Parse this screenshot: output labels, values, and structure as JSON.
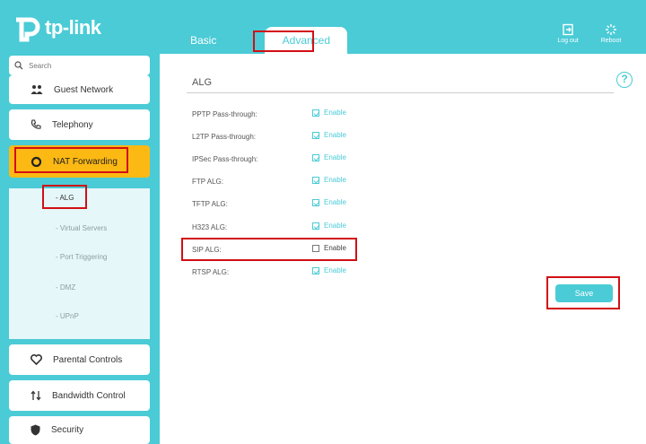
{
  "brand": {
    "logo_text": "tp-link"
  },
  "tabs": [
    {
      "label": "Basic"
    },
    {
      "label": "Advanced"
    }
  ],
  "header_actions": [
    {
      "label": "Log out",
      "icon": "logout-icon"
    },
    {
      "label": "Reboot",
      "icon": "reboot-icon"
    }
  ],
  "sidebar": {
    "search_placeholder": "Search",
    "items": [
      {
        "label": "Guest Network",
        "icon": "guest-network-icon"
      },
      {
        "label": "Telephony",
        "icon": "phone-icon"
      },
      {
        "label": "NAT Forwarding",
        "icon": "nat-icon"
      },
      {
        "label": "Parental Controls",
        "icon": "heart-icon"
      },
      {
        "label": "Bandwidth Control",
        "icon": "arrows-icon"
      },
      {
        "label": "Security",
        "icon": "shield-icon"
      }
    ],
    "sub_items": [
      {
        "label": "- ALG"
      },
      {
        "label": "- Virtual Servers"
      },
      {
        "label": "- Port Triggering"
      },
      {
        "label": "- DMZ"
      },
      {
        "label": "- UPnP"
      }
    ]
  },
  "main": {
    "section_title": "ALG",
    "help_icon": "?",
    "rows": [
      {
        "label": "PPTP Pass-through:",
        "option": "Enable",
        "checked": true
      },
      {
        "label": "L2TP Pass-through:",
        "option": "Enable",
        "checked": true
      },
      {
        "label": "IPSec Pass-through:",
        "option": "Enable",
        "checked": true
      },
      {
        "label": "FTP ALG:",
        "option": "Enable",
        "checked": true
      },
      {
        "label": "TFTP ALG:",
        "option": "Enable",
        "checked": true
      },
      {
        "label": "H323 ALG:",
        "option": "Enable",
        "checked": true
      },
      {
        "label": "SIP ALG:",
        "option": "Enable",
        "checked": false
      },
      {
        "label": "RTSP ALG:",
        "option": "Enable",
        "checked": true
      }
    ],
    "save_label": "Save"
  },
  "colors": {
    "accent": "#4acbd6",
    "highlight": "#d10f14",
    "active_nav": "#fdb913"
  }
}
